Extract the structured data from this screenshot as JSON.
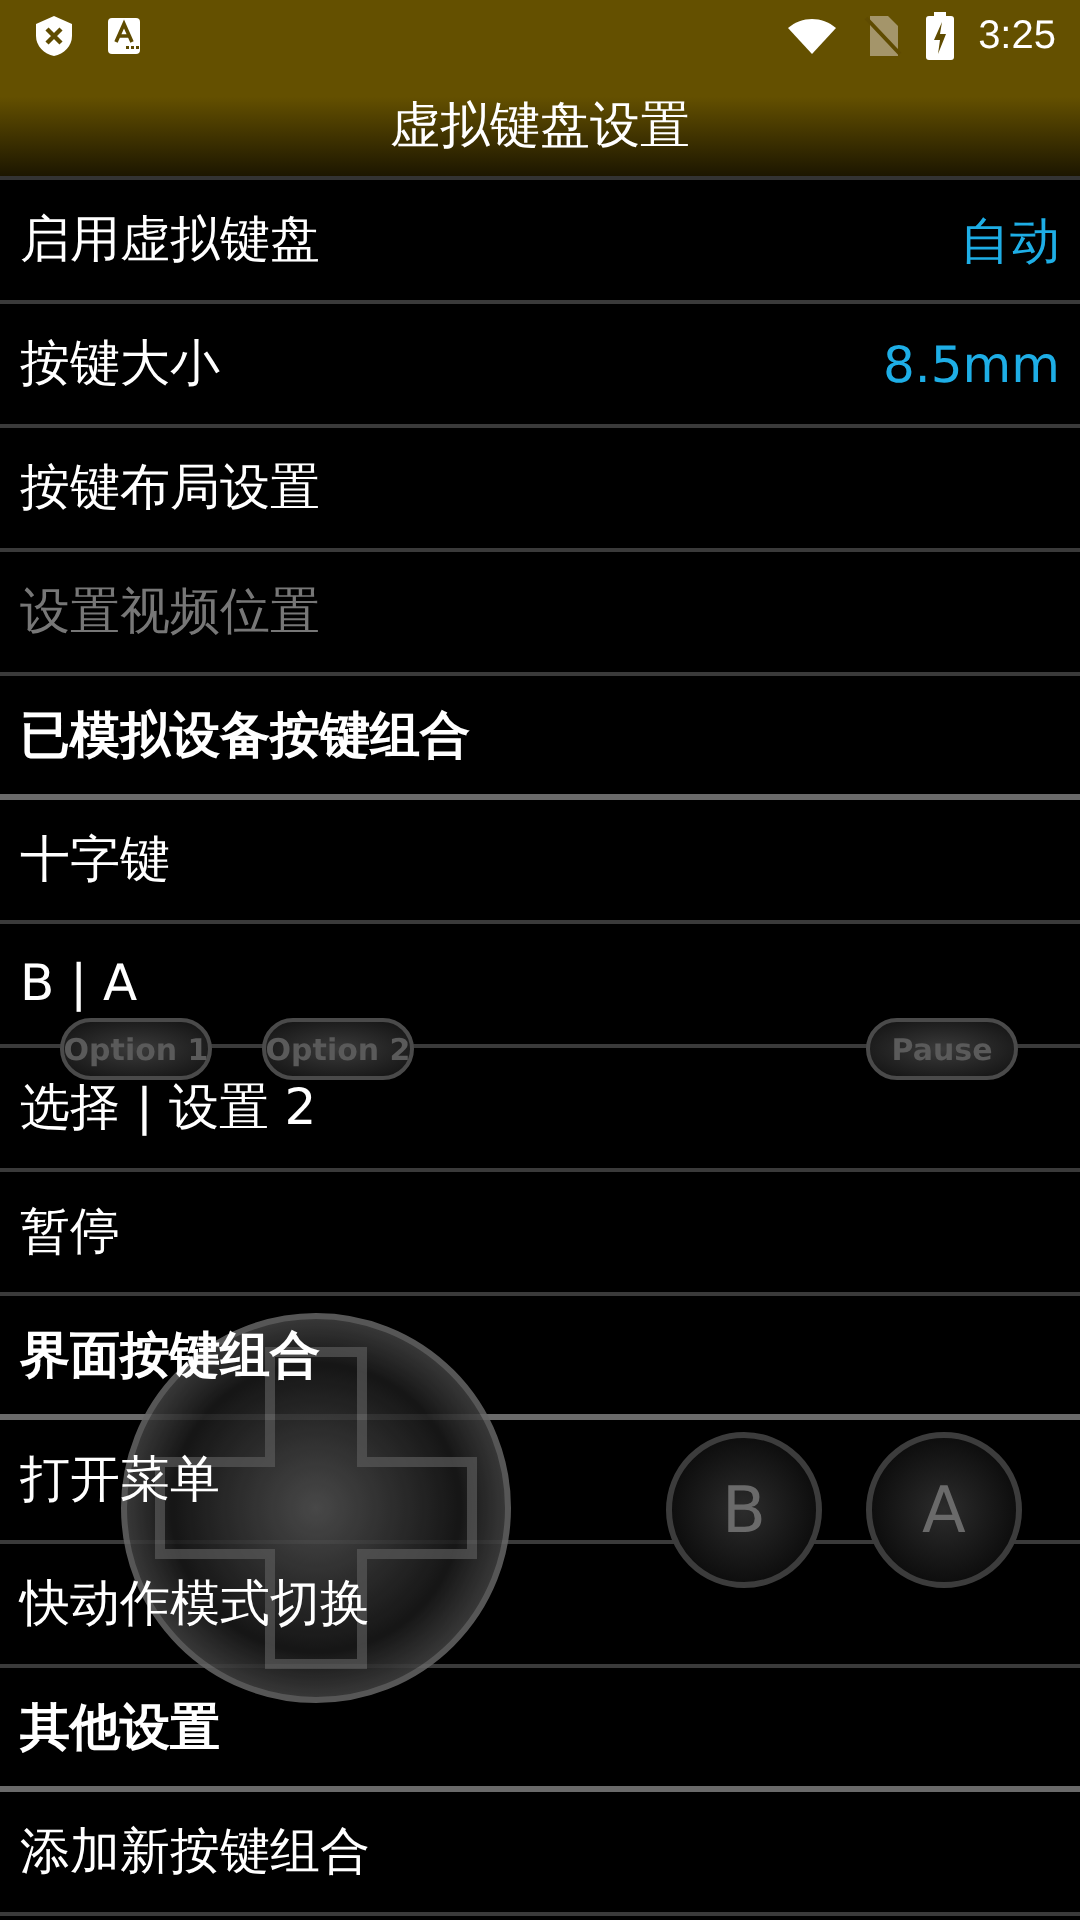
{
  "status_bar": {
    "time": "3:25"
  },
  "window": {
    "title": "虚拟键盘设置"
  },
  "rows": [
    {
      "kind": "setting",
      "label": "启用虚拟键盘",
      "value": "自动",
      "disabled": false
    },
    {
      "kind": "setting",
      "label": "按键大小",
      "value": "8.5mm",
      "disabled": false
    },
    {
      "kind": "setting",
      "label": "按键布局设置",
      "disabled": false
    },
    {
      "kind": "setting",
      "label": "设置视频位置",
      "disabled": true
    },
    {
      "kind": "header",
      "label": "已模拟设备按键组合"
    },
    {
      "kind": "setting",
      "label": "十字键",
      "disabled": false
    },
    {
      "kind": "setting",
      "label": "B | A",
      "disabled": false
    },
    {
      "kind": "setting",
      "label": "选择 | 设置 2",
      "disabled": false
    },
    {
      "kind": "setting",
      "label": "暂停",
      "disabled": false
    },
    {
      "kind": "header",
      "label": "界面按键组合"
    },
    {
      "kind": "setting",
      "label": "打开菜单",
      "disabled": false
    },
    {
      "kind": "setting",
      "label": "快动作模式切换",
      "disabled": false
    },
    {
      "kind": "header",
      "label": "其他设置"
    },
    {
      "kind": "setting",
      "label": "添加新按键组合",
      "disabled": false
    }
  ],
  "overlay": [
    {
      "kind": "pill",
      "label": "Option 1"
    },
    {
      "kind": "pill",
      "label": "Option 2"
    },
    {
      "kind": "pill",
      "label": "Pause"
    },
    {
      "kind": "dpad"
    },
    {
      "kind": "round",
      "label": "B"
    },
    {
      "kind": "round",
      "label": "A"
    }
  ]
}
